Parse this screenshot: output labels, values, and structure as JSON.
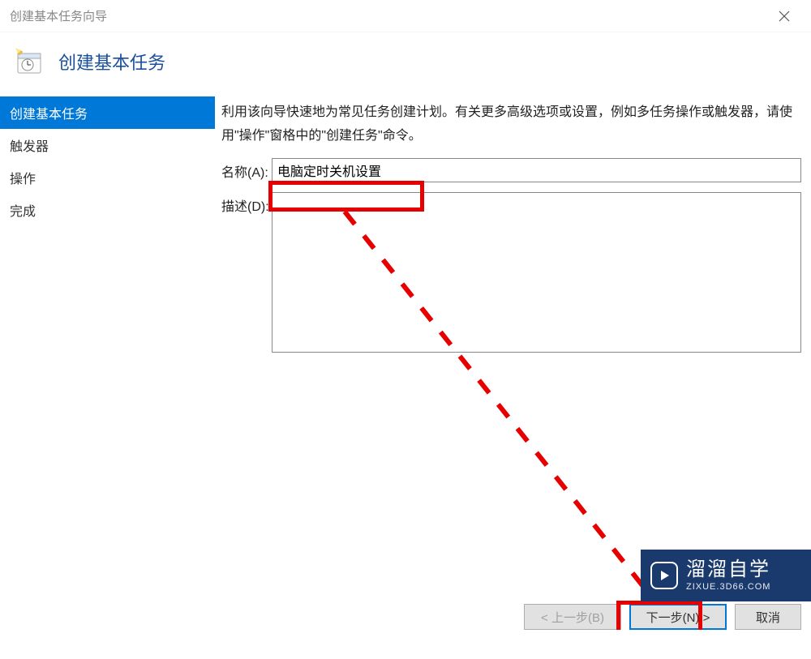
{
  "window": {
    "title": "创建基本任务向导"
  },
  "header": {
    "title": "创建基本任务"
  },
  "sidebar": {
    "items": [
      {
        "label": "创建基本任务",
        "active": true
      },
      {
        "label": "触发器",
        "active": false
      },
      {
        "label": "操作",
        "active": false
      },
      {
        "label": "完成",
        "active": false
      }
    ]
  },
  "main": {
    "intro": "利用该向导快速地为常见任务创建计划。有关更多高级选项或设置，例如多任务操作或触发器，请使用\"操作\"窗格中的\"创建任务\"命令。",
    "name_label": "名称(A):",
    "name_value": "电脑定时关机设置",
    "desc_label": "描述(D):",
    "desc_value": ""
  },
  "buttons": {
    "back": "< 上一步(B)",
    "next": "下一步(N) >",
    "cancel": "取消"
  },
  "watermark": {
    "main": "溜溜自学",
    "sub": "ZIXUE.3D66.COM"
  }
}
